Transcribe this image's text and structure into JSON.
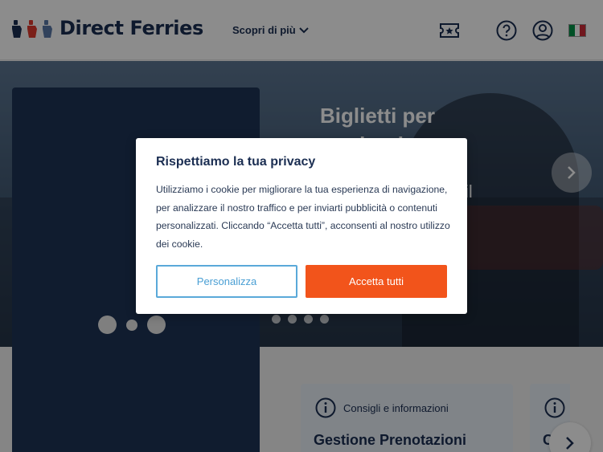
{
  "header": {
    "brand": "Direct Ferries",
    "nav_more": "Scopri di più",
    "icons": [
      "ticket-icon",
      "help-icon",
      "account-icon",
      "flag-it-icon"
    ],
    "flag_colors": [
      "#009246",
      "#ffffff",
      "#ce2b37"
    ]
  },
  "hero": {
    "title_line1": "Biglietti per",
    "title_line2": "traghetti",
    "partial_text": "il",
    "carousel_dots": 4
  },
  "cards": [
    {
      "kicker": "Consigli e informazioni",
      "title": "Gestione Prenotazioni"
    },
    {
      "kicker": "",
      "title": "C"
    }
  ],
  "cookie_modal": {
    "title": "Rispettiamo la tua privacy",
    "body": "Utilizziamo i cookie per migliorare la tua esperienza di navigazione, per analizzare il nostro traffico e per inviarti pubblicità o contenuti personalizzati. Cliccando “Accetta tutti”, acconsenti al nostro utilizzo dei cookie.",
    "customize_label": "Personalizza",
    "accept_label": "Accetta tutti"
  },
  "colors": {
    "navy": "#1b2e52",
    "accent": "#f2541b",
    "link_blue": "#4a9fd4"
  }
}
